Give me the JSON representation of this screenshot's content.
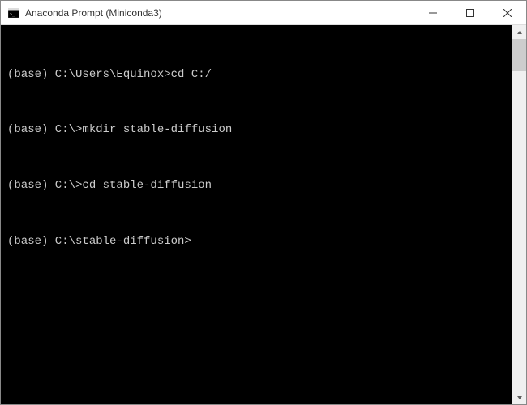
{
  "window": {
    "title": "Anaconda Prompt (Miniconda3)"
  },
  "terminal": {
    "lines": [
      {
        "prompt": "(base) C:\\Users\\Equinox>",
        "command": "cd C:/"
      },
      {
        "prompt": "(base) C:\\>",
        "command": "mkdir stable-diffusion"
      },
      {
        "prompt": "(base) C:\\>",
        "command": "cd stable-diffusion"
      },
      {
        "prompt": "(base) C:\\stable-diffusion>",
        "command": ""
      }
    ]
  },
  "colors": {
    "terminal_bg": "#000000",
    "terminal_fg": "#cccccc",
    "titlebar_bg": "#ffffff"
  }
}
